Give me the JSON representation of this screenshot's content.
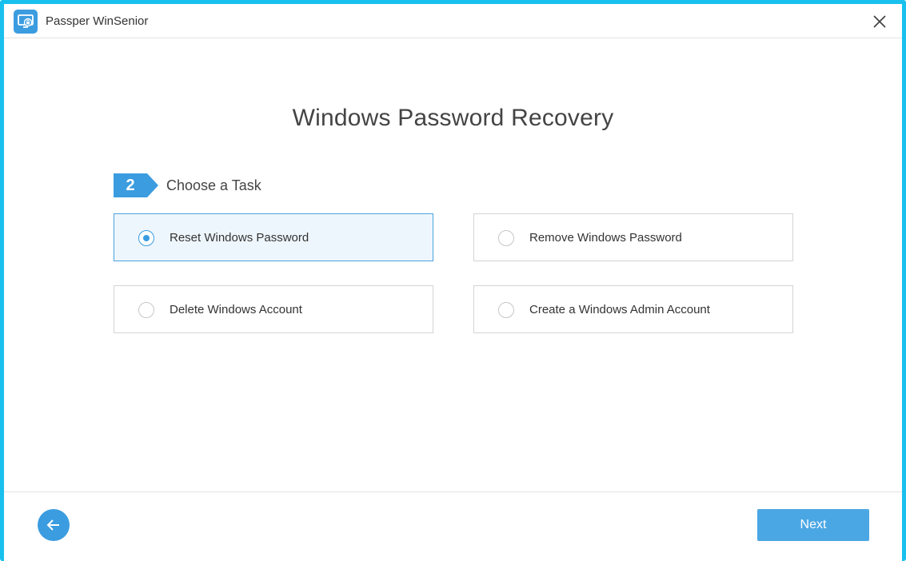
{
  "window": {
    "title": "Passper WinSenior",
    "icon": "monitor-lock-icon",
    "close_icon": "close-icon",
    "border_color": "#19c0ee"
  },
  "main": {
    "title": "Windows Password Recovery",
    "step": {
      "number": "2",
      "label": "Choose a Task"
    },
    "options": [
      {
        "label": "Reset Windows Password",
        "selected": true
      },
      {
        "label": "Remove Windows Password",
        "selected": false
      },
      {
        "label": "Delete Windows Account",
        "selected": false
      },
      {
        "label": "Create a Windows Admin Account",
        "selected": false
      }
    ]
  },
  "footer": {
    "back_icon": "arrow-left-icon",
    "next_label": "Next"
  },
  "colors": {
    "accent": "#3b9ce0",
    "selected_bg": "#eef6fd",
    "button": "#4ba7e4"
  }
}
